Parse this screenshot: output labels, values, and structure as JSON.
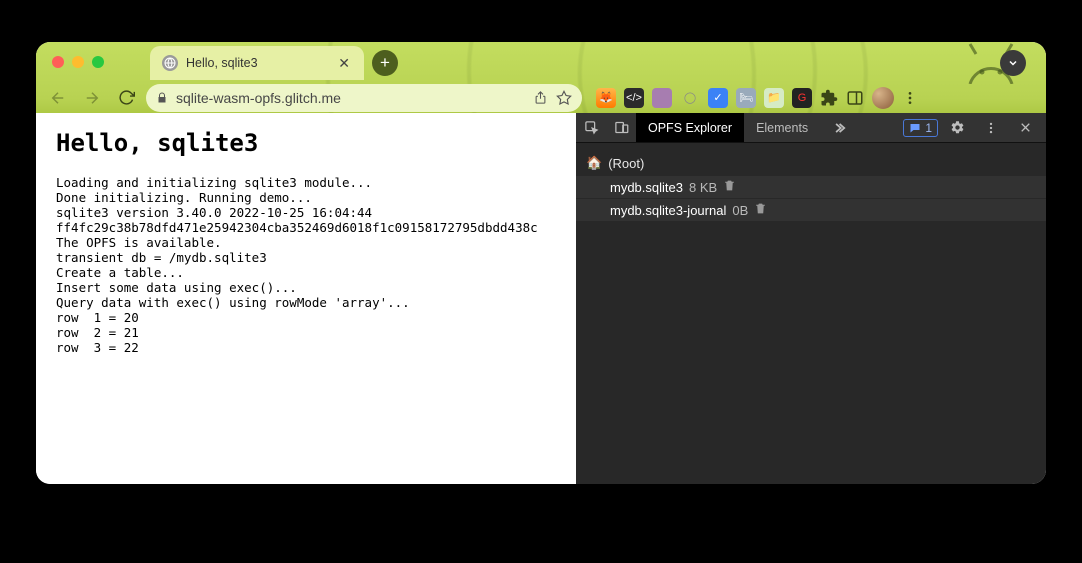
{
  "browser": {
    "tab_title": "Hello, sqlite3",
    "url": "sqlite-wasm-opfs.glitch.me",
    "issues_count": "1"
  },
  "page": {
    "heading": "Hello, sqlite3",
    "lines": [
      "Loading and initializing sqlite3 module...",
      "Done initializing. Running demo...",
      "sqlite3 version 3.40.0 2022-10-25 16:04:44",
      "ff4fc29c38b78dfd471e25942304cba352469d6018f1c09158172795dbdd438c",
      "The OPFS is available.",
      "transient db = /mydb.sqlite3",
      "Create a table...",
      "Insert some data using exec()...",
      "Query data with exec() using rowMode 'array'...",
      "row  1 = 20",
      "row  2 = 21",
      "row  3 = 22"
    ]
  },
  "devtools": {
    "tabs": {
      "active": "OPFS Explorer",
      "other": "Elements"
    },
    "root_label": "(Root)",
    "files": [
      {
        "name": "mydb.sqlite3",
        "size": "8 KB"
      },
      {
        "name": "mydb.sqlite3-journal",
        "size": "0B"
      }
    ]
  }
}
